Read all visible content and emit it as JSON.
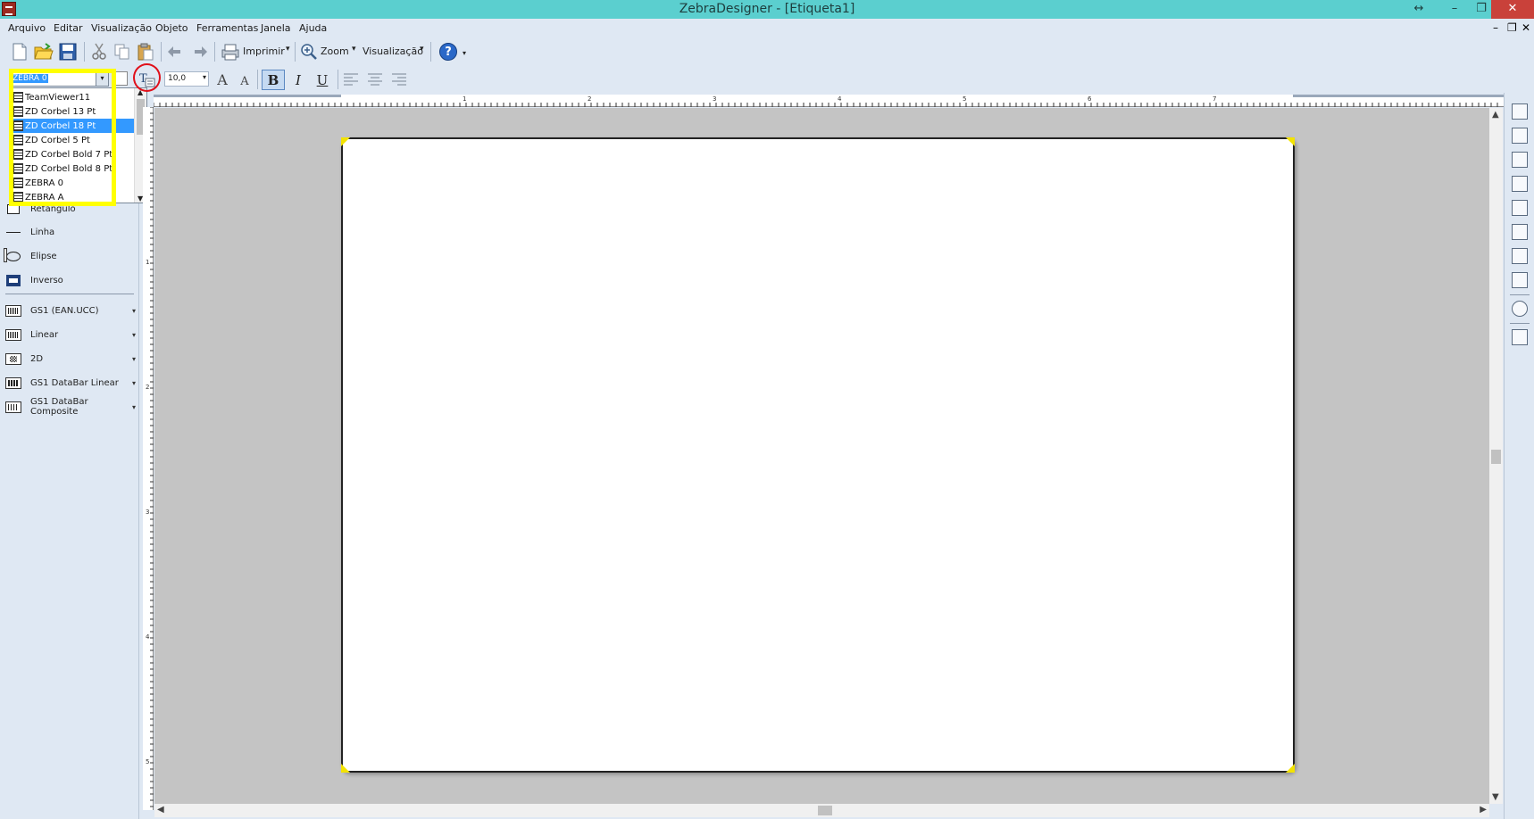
{
  "window": {
    "title": "ZebraDesigner - [Etiqueta1]",
    "resize_glyph": "↔",
    "minimize": "–",
    "restore": "❐",
    "close": "✕"
  },
  "menu": {
    "items": [
      "Arquivo",
      "Editar",
      "Visualização",
      "Objeto",
      "Ferramentas",
      "Janela",
      "Ajuda"
    ],
    "mdi_minimize": "–",
    "mdi_restore": "❐",
    "mdi_close": "✕"
  },
  "toolbar": {
    "print_label": "Imprimir",
    "zoom_label": "Zoom",
    "view_label": "Visualização",
    "dropdown_arrow": "▾",
    "help_glyph": "?"
  },
  "format_toolbar": {
    "font_value": "ZEBRA 0",
    "size_value": "10,0",
    "bold": "B",
    "italic": "I",
    "underline": "U",
    "grow_font": "A",
    "shrink_font": "A"
  },
  "font_list": {
    "items": [
      "TeamViewer11",
      "ZD Corbel 13 Pt",
      "ZD Corbel 18 Pt",
      "ZD Corbel 5 Pt",
      "ZD Corbel Bold 7 Pt",
      "ZD Corbel Bold 8 Pt",
      "ZEBRA 0",
      "ZEBRA A"
    ],
    "selected_index": 2
  },
  "left_panel": {
    "items": [
      "Retângulo",
      "Linha",
      "Elipse",
      "Inverso",
      "GS1 (EAN.UCC)",
      "Linear",
      "2D",
      "GS1 DataBar Linear",
      "GS1 DataBar Composite"
    ],
    "dropdown_glyph": "▾"
  },
  "ruler": {
    "h_numbers": [
      "1",
      "2",
      "3",
      "4",
      "5",
      "6",
      "7"
    ],
    "v_numbers": [
      "1",
      "2",
      "3",
      "4",
      "5"
    ]
  },
  "scroll": {
    "up": "▲",
    "down": "▼",
    "left": "◀",
    "right": "▶"
  },
  "colors": {
    "titlebar": "#5bcfcf",
    "chrome": "#dfe8f3",
    "highlight_box": "#ffff00",
    "annotation_circle": "#e0101a",
    "selection": "#3399ff",
    "canvas": "#c4c4c4"
  },
  "icons": {
    "toolbar": [
      "new-document-icon",
      "open-folder-icon",
      "save-icon",
      "cut-icon",
      "copy-icon",
      "paste-icon",
      "undo-icon",
      "redo-icon",
      "printer-icon",
      "zoom-icon",
      "help-icon"
    ],
    "format": [
      "font-size-icon",
      "text-grow-icon",
      "text-shrink-icon",
      "bold-icon",
      "italic-icon",
      "underline-icon",
      "align-left-icon",
      "align-center-icon",
      "align-right-icon"
    ],
    "right": [
      "align-top-icon",
      "align-middle-icon",
      "align-bottom-icon",
      "align-left-edges-icon",
      "align-center-vertical-icon",
      "align-right-edges-icon",
      "distribute-horizontal-icon",
      "distribute-vertical-icon",
      "rotate-icon",
      "order-icon"
    ]
  }
}
